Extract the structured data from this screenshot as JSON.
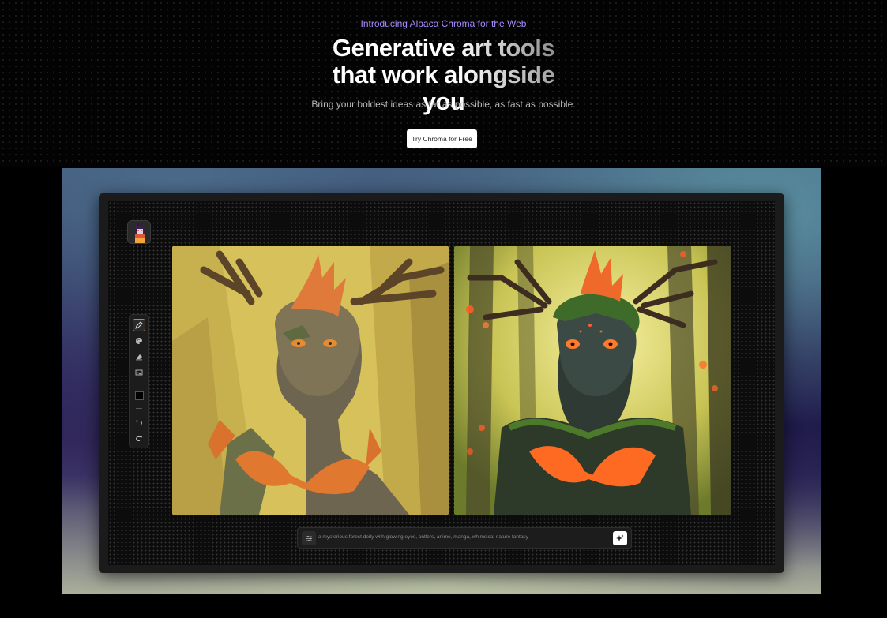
{
  "hero": {
    "eyebrow": "Introducing Alpaca Chroma for the Web",
    "headline_line1": "Generative art tools",
    "headline_line2": "that work alongside you",
    "subtitle": "Bring your boldest ideas as far as possible, as fast as possible.",
    "cta_label": "Try Chroma for Free"
  },
  "app": {
    "logo_icon": "alpaca-logo-icon",
    "toolbar": {
      "tools": [
        "brush-icon",
        "palette-icon",
        "eraser-icon",
        "image-icon"
      ],
      "active_tool": "brush-icon",
      "current_color": "#000000",
      "history": [
        "undo-icon",
        "redo-icon"
      ]
    },
    "canvas": {
      "sketch_image": "forest-deity-sketch",
      "render_image": "forest-deity-render"
    },
    "prompt": {
      "text": "a mysterious forest deity with glowing eyes, antlers, anime, manga, whimsical nature fantasy",
      "settings_icon": "sliders-icon",
      "generate_icon": "sparkle-icon"
    }
  },
  "colors": {
    "accent": "#a98bff",
    "brush_active": "#e07a4a"
  }
}
